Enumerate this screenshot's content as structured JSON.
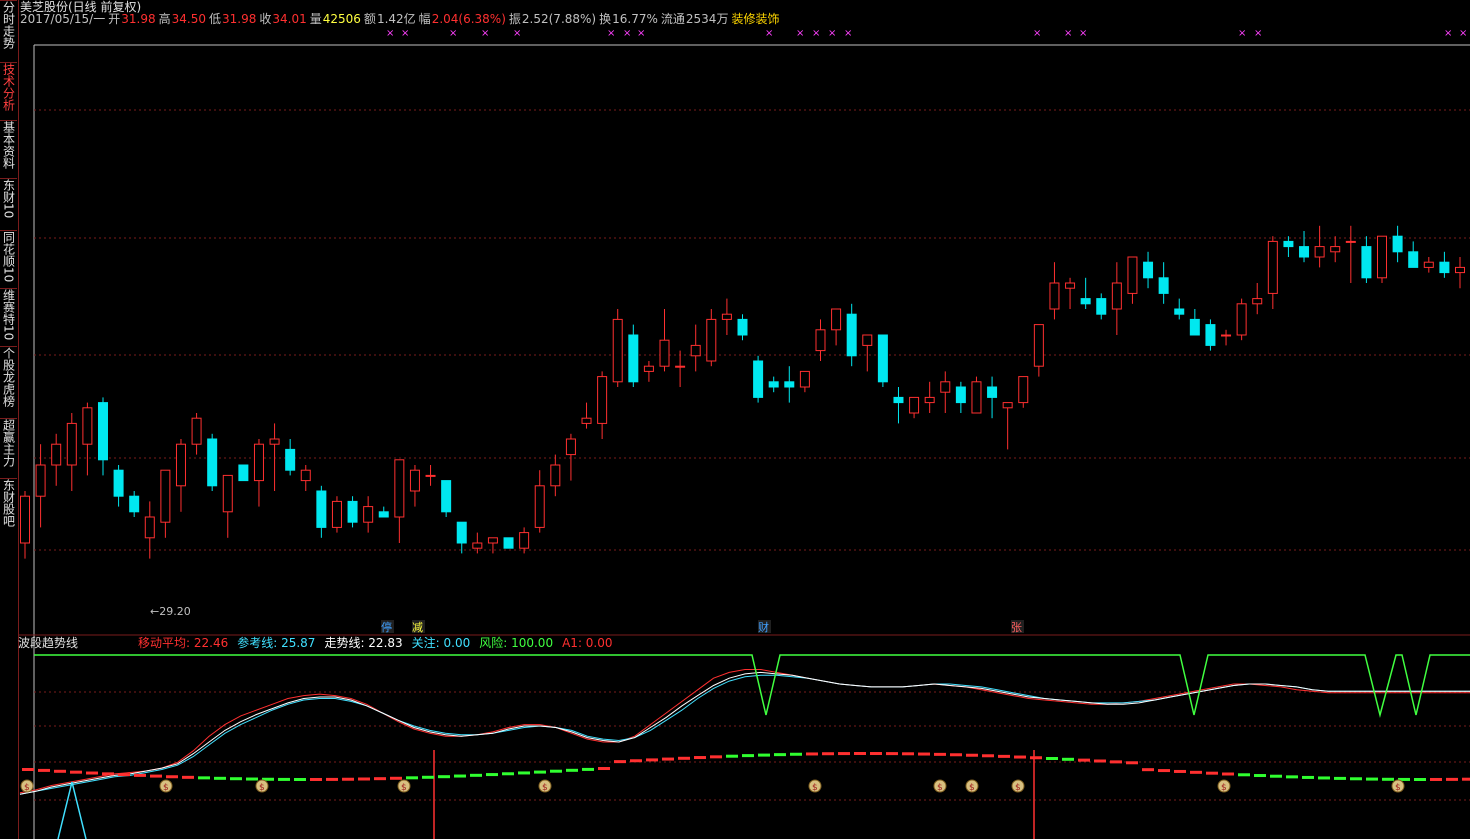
{
  "sidebar": {
    "tabs": [
      {
        "label": "分时走势",
        "active": false
      },
      {
        "label": "技术分析",
        "active": true
      },
      {
        "label": "基本资料",
        "active": false
      },
      {
        "label": "东财10",
        "active": false
      },
      {
        "label": "同花顺10",
        "active": false
      },
      {
        "label": "维赛特10",
        "active": false
      },
      {
        "label": "个股龙虎榜",
        "active": false
      },
      {
        "label": "超赢主力",
        "active": false
      },
      {
        "label": "东财股吧",
        "active": false
      }
    ]
  },
  "header": {
    "title": "美芝股份(日线 前复权)",
    "date": "2017/05/15/一",
    "open_label": "开",
    "open": "31.98",
    "high_label": "高",
    "high": "34.50",
    "low_label": "低",
    "low": "31.98",
    "close_label": "收",
    "close": "34.01",
    "volume_label": "量",
    "volume": "42506",
    "amount_label": "额",
    "amount": "1.42亿",
    "change_label": "幅",
    "change": "2.04(6.38%)",
    "amplitude_label": "振",
    "amplitude": "2.52(7.88%)",
    "turnover_label": "换",
    "turnover": "16.77%",
    "float_label": "流通",
    "float": "2534万",
    "sector": "装修装饰"
  },
  "markers": {
    "min_price_label": "←29.20",
    "events": [
      {
        "label": "停",
        "color": "#40a0ff"
      },
      {
        "label": "减",
        "color": "#ffff40"
      },
      {
        "label": "财",
        "color": "#40a0ff"
      },
      {
        "label": "张",
        "color": "#ff6060"
      }
    ],
    "star_symbol": "×"
  },
  "indicator": {
    "name": "波段趋势线",
    "items": [
      {
        "label": "移动平均: 22.46",
        "color": "#ff3030"
      },
      {
        "label": "参考线: 25.87",
        "color": "#40e0ff"
      },
      {
        "label": "走势线: 22.83",
        "color": "#ffffff"
      },
      {
        "label": "关注: 0.00",
        "color": "#40e0ff"
      },
      {
        "label": "风险: 100.00",
        "color": "#40ff40"
      },
      {
        "label": "A1: 0.00",
        "color": "#ff3030"
      }
    ],
    "coin_glyph": "$"
  },
  "colors": {
    "up": "#ff3030",
    "down": "#00e8f0",
    "grid": "#7a1c1c",
    "ma": "#ff3030",
    "ref": "#40e0ff",
    "trend": "#ffffff",
    "risk": "#40ff40",
    "bar_up": "#ff3030",
    "bar_down": "#30ff30"
  },
  "chart_data": [
    {
      "type": "candlestick",
      "title": "美芝股份(日线 前复权)",
      "min_marker": 29.2,
      "ylim": [
        28.5,
        38.5
      ],
      "candles": [
        {
          "o": 29.5,
          "h": 30.5,
          "l": 29.2,
          "c": 30.4
        },
        {
          "o": 30.4,
          "h": 31.4,
          "l": 29.8,
          "c": 31.0
        },
        {
          "o": 31.0,
          "h": 31.6,
          "l": 30.6,
          "c": 31.4
        },
        {
          "o": 31.0,
          "h": 32.0,
          "l": 30.5,
          "c": 31.8
        },
        {
          "o": 31.4,
          "h": 32.2,
          "l": 30.8,
          "c": 32.1
        },
        {
          "o": 32.2,
          "h": 32.3,
          "l": 30.8,
          "c": 31.1
        },
        {
          "o": 30.9,
          "h": 31.0,
          "l": 30.2,
          "c": 30.4
        },
        {
          "o": 30.4,
          "h": 30.5,
          "l": 30.0,
          "c": 30.1
        },
        {
          "o": 29.6,
          "h": 30.3,
          "l": 29.2,
          "c": 30.0
        },
        {
          "o": 29.9,
          "h": 30.9,
          "l": 29.6,
          "c": 30.9
        },
        {
          "o": 30.6,
          "h": 31.5,
          "l": 30.1,
          "c": 31.4
        },
        {
          "o": 31.4,
          "h": 32.0,
          "l": 31.2,
          "c": 31.9
        },
        {
          "o": 31.5,
          "h": 31.6,
          "l": 30.5,
          "c": 30.6
        },
        {
          "o": 30.1,
          "h": 30.8,
          "l": 29.6,
          "c": 30.8
        },
        {
          "o": 31.0,
          "h": 31.0,
          "l": 30.7,
          "c": 30.7
        },
        {
          "o": 30.7,
          "h": 31.5,
          "l": 30.2,
          "c": 31.4
        },
        {
          "o": 31.4,
          "h": 31.8,
          "l": 30.5,
          "c": 31.5
        },
        {
          "o": 31.3,
          "h": 31.5,
          "l": 30.8,
          "c": 30.9
        },
        {
          "o": 30.7,
          "h": 31.0,
          "l": 30.5,
          "c": 30.9
        },
        {
          "o": 30.5,
          "h": 30.6,
          "l": 29.6,
          "c": 29.8
        },
        {
          "o": 29.8,
          "h": 30.4,
          "l": 29.7,
          "c": 30.3
        },
        {
          "o": 30.3,
          "h": 30.4,
          "l": 29.8,
          "c": 29.9
        },
        {
          "o": 29.9,
          "h": 30.4,
          "l": 29.7,
          "c": 30.2
        },
        {
          "o": 30.1,
          "h": 30.2,
          "l": 30.0,
          "c": 30.0
        },
        {
          "o": 30.0,
          "h": 31.1,
          "l": 29.5,
          "c": 31.1
        },
        {
          "o": 30.5,
          "h": 31.0,
          "l": 30.2,
          "c": 30.9
        },
        {
          "o": 30.8,
          "h": 31.0,
          "l": 30.6,
          "c": 30.8
        },
        {
          "o": 30.7,
          "h": 30.7,
          "l": 30.0,
          "c": 30.1
        },
        {
          "o": 29.9,
          "h": 29.9,
          "l": 29.3,
          "c": 29.5
        },
        {
          "o": 29.4,
          "h": 29.7,
          "l": 29.3,
          "c": 29.5
        },
        {
          "o": 29.5,
          "h": 29.6,
          "l": 29.3,
          "c": 29.6
        },
        {
          "o": 29.6,
          "h": 29.6,
          "l": 29.4,
          "c": 29.4
        },
        {
          "o": 29.4,
          "h": 29.8,
          "l": 29.3,
          "c": 29.7
        },
        {
          "o": 29.8,
          "h": 30.9,
          "l": 29.7,
          "c": 30.6
        },
        {
          "o": 30.6,
          "h": 31.2,
          "l": 30.4,
          "c": 31.0
        },
        {
          "o": 31.2,
          "h": 31.6,
          "l": 30.7,
          "c": 31.5
        },
        {
          "o": 31.8,
          "h": 32.2,
          "l": 31.7,
          "c": 31.9
        },
        {
          "o": 31.8,
          "h": 32.8,
          "l": 31.5,
          "c": 32.7
        },
        {
          "o": 32.6,
          "h": 34.0,
          "l": 32.5,
          "c": 33.8
        },
        {
          "o": 33.5,
          "h": 33.7,
          "l": 32.5,
          "c": 32.6
        },
        {
          "o": 32.8,
          "h": 33.0,
          "l": 32.6,
          "c": 32.9
        },
        {
          "o": 32.9,
          "h": 34.0,
          "l": 32.8,
          "c": 33.4
        },
        {
          "o": 32.9,
          "h": 33.2,
          "l": 32.5,
          "c": 32.9
        },
        {
          "o": 33.1,
          "h": 33.7,
          "l": 32.8,
          "c": 33.3
        },
        {
          "o": 33.0,
          "h": 34.0,
          "l": 32.9,
          "c": 33.8
        },
        {
          "o": 33.8,
          "h": 34.2,
          "l": 33.5,
          "c": 33.9
        },
        {
          "o": 33.8,
          "h": 33.9,
          "l": 33.4,
          "c": 33.5
        },
        {
          "o": 33.0,
          "h": 33.1,
          "l": 32.2,
          "c": 32.3
        },
        {
          "o": 32.6,
          "h": 32.7,
          "l": 32.4,
          "c": 32.5
        },
        {
          "o": 32.6,
          "h": 32.9,
          "l": 32.2,
          "c": 32.5
        },
        {
          "o": 32.5,
          "h": 32.8,
          "l": 32.4,
          "c": 32.8
        },
        {
          "o": 33.2,
          "h": 33.8,
          "l": 33.0,
          "c": 33.6
        },
        {
          "o": 33.6,
          "h": 34.0,
          "l": 33.3,
          "c": 34.0
        },
        {
          "o": 33.9,
          "h": 34.1,
          "l": 32.9,
          "c": 33.1
        },
        {
          "o": 33.3,
          "h": 33.5,
          "l": 32.8,
          "c": 33.5
        },
        {
          "o": 33.5,
          "h": 33.5,
          "l": 32.5,
          "c": 32.6
        },
        {
          "o": 32.3,
          "h": 32.5,
          "l": 31.8,
          "c": 32.2
        },
        {
          "o": 32.0,
          "h": 32.3,
          "l": 31.9,
          "c": 32.3
        },
        {
          "o": 32.2,
          "h": 32.6,
          "l": 32.0,
          "c": 32.3
        },
        {
          "o": 32.4,
          "h": 32.8,
          "l": 32.0,
          "c": 32.6
        },
        {
          "o": 32.5,
          "h": 32.6,
          "l": 32.0,
          "c": 32.2
        },
        {
          "o": 32.0,
          "h": 32.7,
          "l": 32.0,
          "c": 32.6
        },
        {
          "o": 32.5,
          "h": 32.7,
          "l": 31.9,
          "c": 32.3
        },
        {
          "o": 32.1,
          "h": 32.2,
          "l": 31.3,
          "c": 32.2
        },
        {
          "o": 32.2,
          "h": 32.7,
          "l": 32.1,
          "c": 32.7
        },
        {
          "o": 32.9,
          "h": 33.7,
          "l": 32.7,
          "c": 33.7
        },
        {
          "o": 34.0,
          "h": 34.9,
          "l": 33.8,
          "c": 34.5
        },
        {
          "o": 34.4,
          "h": 34.6,
          "l": 34.0,
          "c": 34.5
        },
        {
          "o": 34.2,
          "h": 34.6,
          "l": 34.0,
          "c": 34.1
        },
        {
          "o": 34.2,
          "h": 34.3,
          "l": 33.8,
          "c": 33.9
        },
        {
          "o": 34.0,
          "h": 34.9,
          "l": 33.5,
          "c": 34.5
        },
        {
          "o": 34.3,
          "h": 35.0,
          "l": 34.1,
          "c": 35.0
        },
        {
          "o": 34.9,
          "h": 35.1,
          "l": 34.4,
          "c": 34.6
        },
        {
          "o": 34.6,
          "h": 34.9,
          "l": 34.1,
          "c": 34.3
        },
        {
          "o": 34.0,
          "h": 34.2,
          "l": 33.8,
          "c": 33.9
        },
        {
          "o": 33.8,
          "h": 34.0,
          "l": 33.5,
          "c": 33.5
        },
        {
          "o": 33.7,
          "h": 33.8,
          "l": 33.2,
          "c": 33.3
        },
        {
          "o": 33.5,
          "h": 33.6,
          "l": 33.3,
          "c": 33.5
        },
        {
          "o": 33.5,
          "h": 34.2,
          "l": 33.4,
          "c": 34.1
        },
        {
          "o": 34.1,
          "h": 34.5,
          "l": 33.9,
          "c": 34.2
        },
        {
          "o": 34.3,
          "h": 35.4,
          "l": 34.0,
          "c": 35.3
        },
        {
          "o": 35.3,
          "h": 35.4,
          "l": 35.0,
          "c": 35.2
        },
        {
          "o": 35.2,
          "h": 35.5,
          "l": 34.9,
          "c": 35.0
        },
        {
          "o": 35.0,
          "h": 35.6,
          "l": 34.8,
          "c": 35.2
        },
        {
          "o": 35.1,
          "h": 35.4,
          "l": 34.9,
          "c": 35.2
        },
        {
          "o": 35.3,
          "h": 35.6,
          "l": 34.5,
          "c": 35.3
        },
        {
          "o": 35.2,
          "h": 35.4,
          "l": 34.5,
          "c": 34.6
        },
        {
          "o": 34.6,
          "h": 35.4,
          "l": 34.5,
          "c": 35.4
        },
        {
          "o": 35.4,
          "h": 35.6,
          "l": 34.9,
          "c": 35.1
        },
        {
          "o": 35.1,
          "h": 35.3,
          "l": 34.8,
          "c": 34.8
        },
        {
          "o": 34.8,
          "h": 35.0,
          "l": 34.7,
          "c": 34.9
        },
        {
          "o": 34.9,
          "h": 35.1,
          "l": 34.6,
          "c": 34.7
        },
        {
          "o": 34.7,
          "h": 35.0,
          "l": 34.4,
          "c": 34.8
        }
      ]
    },
    {
      "type": "line",
      "title": "波段趋势线",
      "ylim": [
        0,
        100
      ],
      "series": [
        {
          "name": "移动平均",
          "color": "#ff3030",
          "values": [
            5,
            7,
            10,
            12,
            14,
            16,
            18,
            19,
            20,
            22,
            26,
            34,
            44,
            52,
            58,
            62,
            66,
            70,
            72,
            73,
            72,
            70,
            66,
            60,
            54,
            49,
            46,
            44,
            44,
            45,
            47,
            50,
            52,
            52,
            50,
            46,
            42,
            40,
            40,
            44,
            52,
            60,
            68,
            76,
            84,
            88,
            90,
            90,
            88,
            86,
            84,
            82,
            80,
            79,
            78,
            78,
            78,
            79,
            80,
            79,
            78,
            76,
            74,
            72,
            70,
            69,
            68,
            67,
            66,
            66,
            67,
            68,
            70,
            72,
            74,
            76,
            78,
            80,
            80,
            79,
            78,
            76,
            75,
            74,
            74,
            74,
            74,
            74,
            74,
            74,
            74,
            74,
            74
          ]
        },
        {
          "name": "参考线",
          "color": "#40e0ff",
          "values": [
            4,
            6,
            8,
            10,
            12,
            14,
            16,
            17,
            19,
            21,
            24,
            30,
            38,
            46,
            52,
            57,
            62,
            66,
            69,
            70,
            70,
            68,
            65,
            60,
            55,
            51,
            48,
            46,
            45,
            45,
            46,
            48,
            50,
            51,
            50,
            48,
            44,
            42,
            41,
            43,
            48,
            55,
            62,
            70,
            77,
            82,
            85,
            86,
            86,
            85,
            84,
            82,
            80,
            79,
            78,
            78,
            78,
            79,
            80,
            80,
            79,
            78,
            76,
            74,
            72,
            70,
            69,
            68,
            67,
            67,
            67,
            68,
            69,
            71,
            73,
            75,
            77,
            79,
            80,
            80,
            79,
            78,
            76,
            75,
            75,
            75,
            75,
            75,
            75,
            75,
            75,
            75,
            75
          ]
        },
        {
          "name": "走势线",
          "color": "#ffffff",
          "values": [
            4,
            6,
            9,
            11,
            13,
            15,
            17,
            18,
            20,
            22,
            25,
            32,
            40,
            48,
            54,
            59,
            63,
            67,
            70,
            71,
            71,
            69,
            65,
            60,
            55,
            50,
            47,
            45,
            44,
            45,
            46,
            49,
            51,
            51,
            50,
            47,
            43,
            41,
            40,
            43,
            50,
            57,
            65,
            72,
            79,
            84,
            87,
            88,
            87,
            86,
            84,
            82,
            80,
            79,
            78,
            78,
            78,
            79,
            80,
            79,
            78,
            77,
            75,
            73,
            71,
            70,
            69,
            68,
            67,
            66,
            66,
            67,
            69,
            71,
            73,
            75,
            77,
            79,
            80,
            80,
            79,
            78,
            76,
            75,
            75,
            75,
            75,
            75,
            75,
            75,
            75,
            75,
            75
          ]
        }
      ]
    }
  ]
}
